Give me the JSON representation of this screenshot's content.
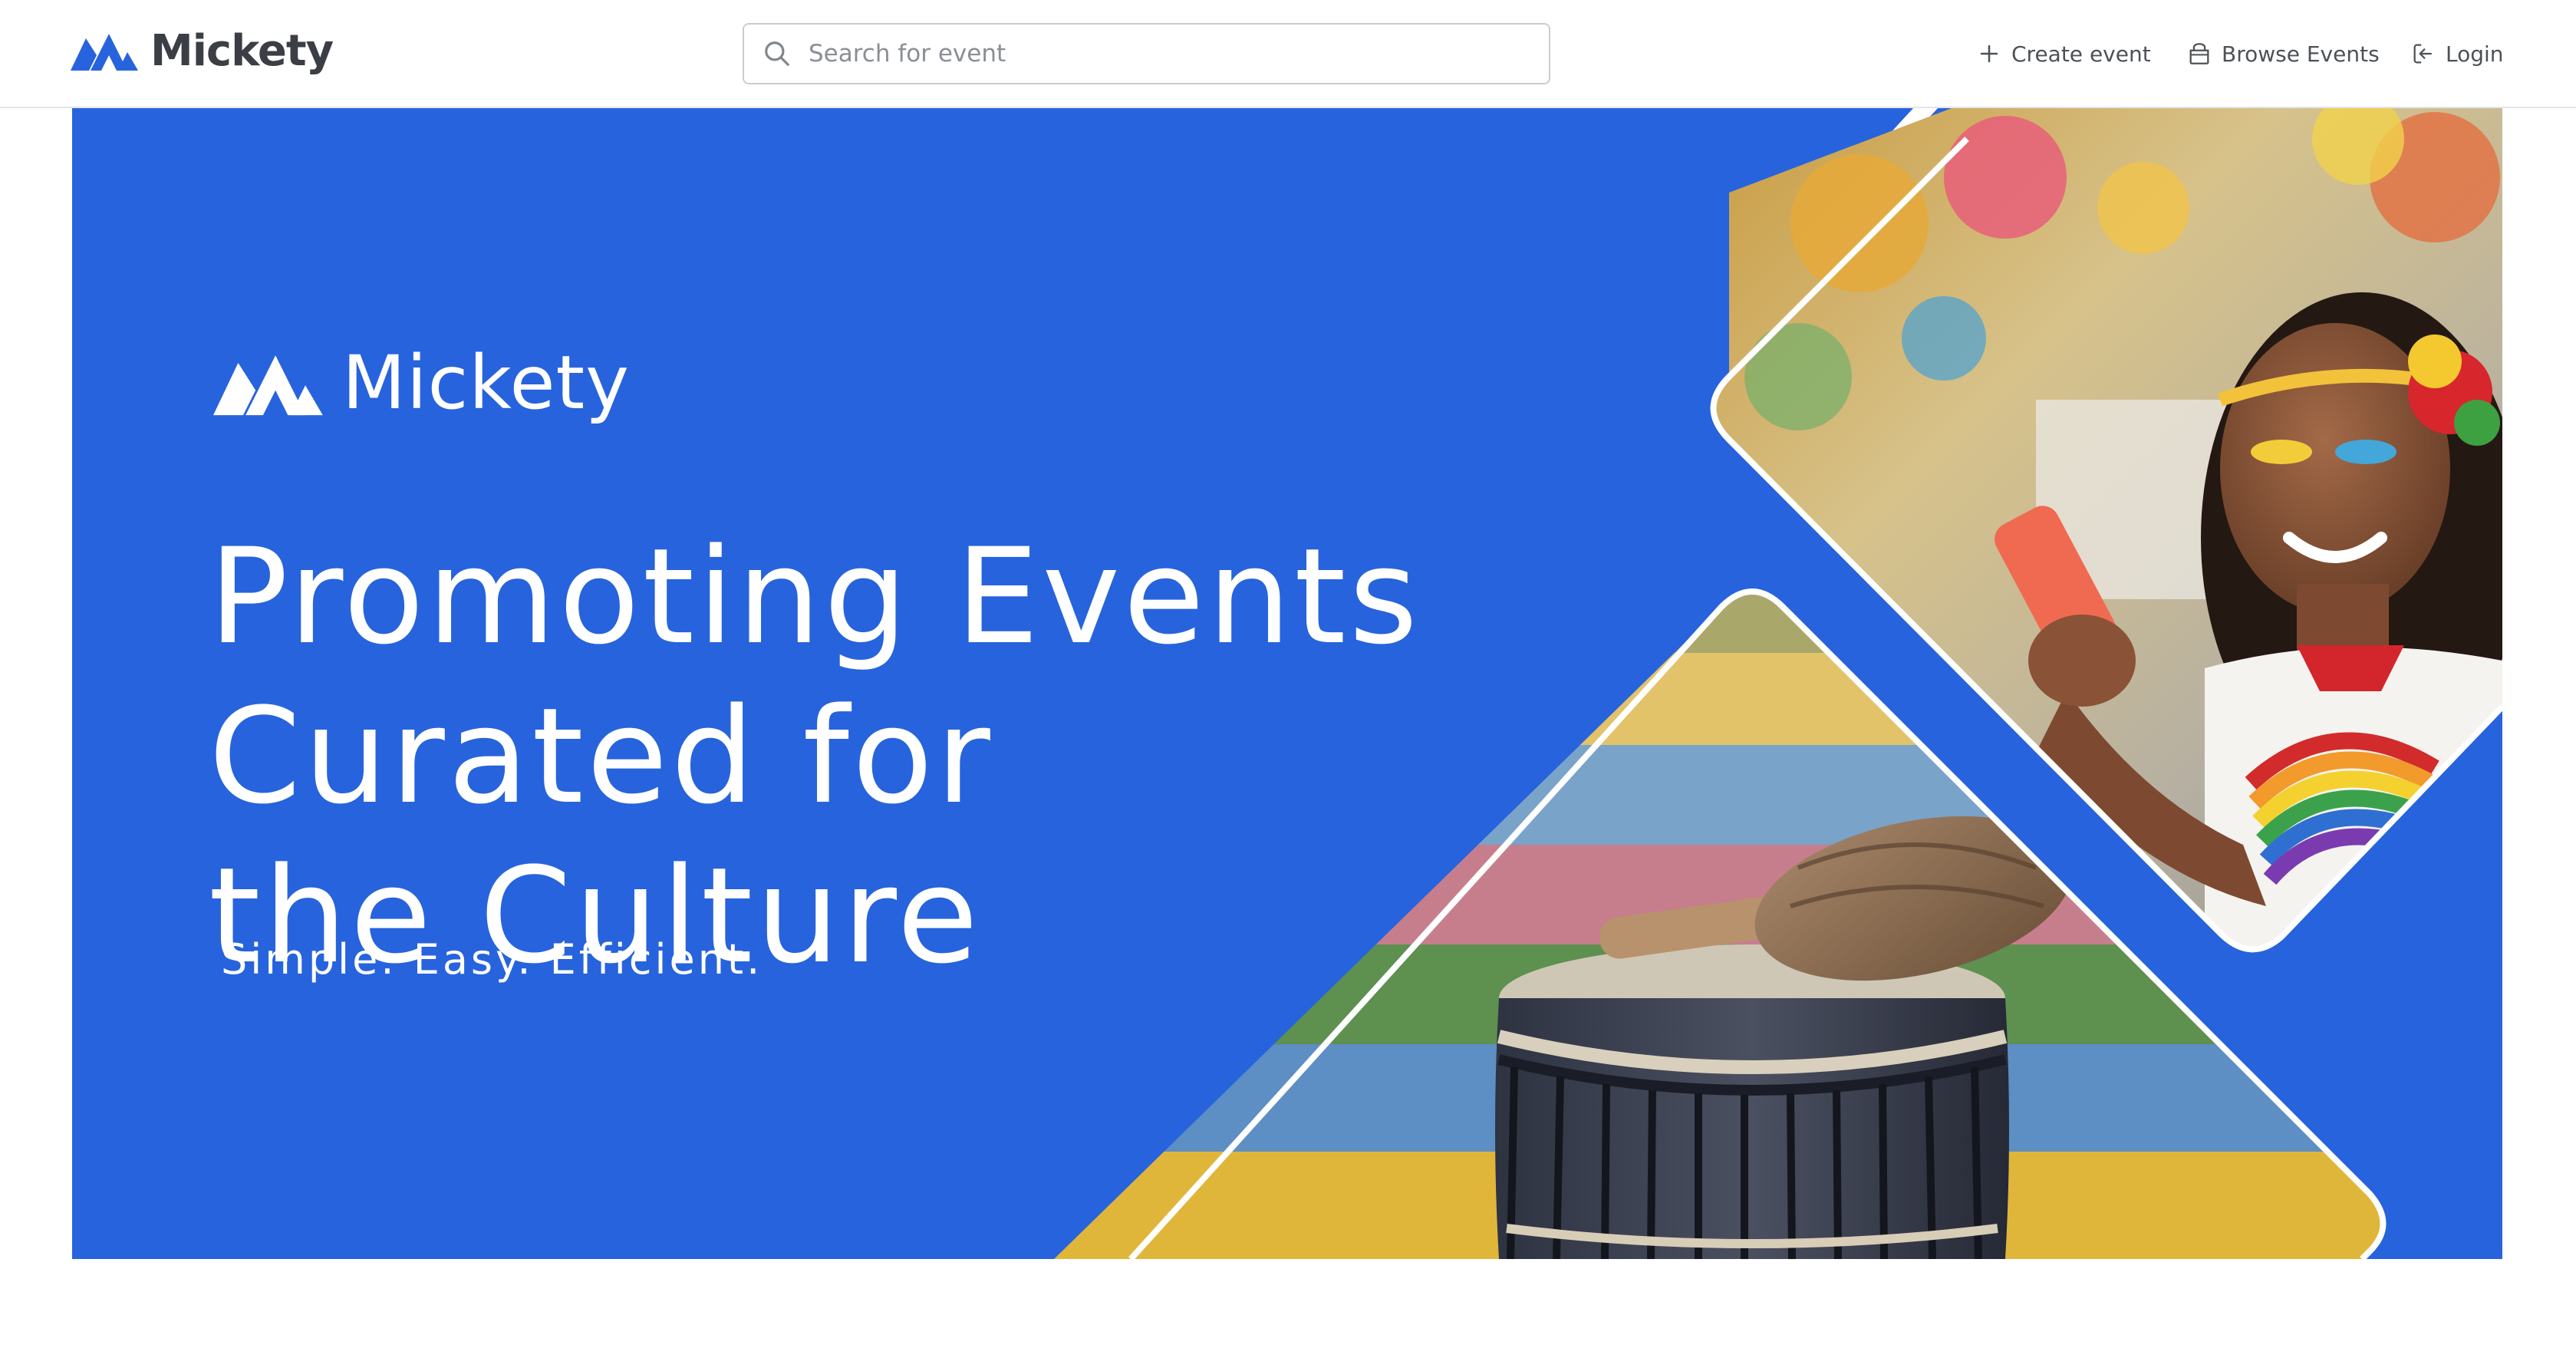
{
  "brand": {
    "name": "Mickety",
    "logo_icon": "mickety-logo-icon",
    "color": "#2763dc"
  },
  "search": {
    "placeholder": "Search for event",
    "value": "",
    "icon": "search-icon"
  },
  "nav": {
    "create": {
      "label": "Create event",
      "icon": "plus-icon"
    },
    "browse": {
      "label": "Browse Events",
      "icon": "store-icon"
    },
    "login": {
      "label": "Login",
      "icon": "login-icon"
    }
  },
  "hero": {
    "background_color": "#2763dc",
    "logo_text": "Mickety",
    "headline_lines": [
      "Promoting Events",
      "Curated for",
      "the Culture"
    ],
    "tagline": "Simple.  Easy.  Efficient.",
    "images": [
      "woman-with-phone-photo",
      "drum-and-maraca-photo"
    ]
  }
}
